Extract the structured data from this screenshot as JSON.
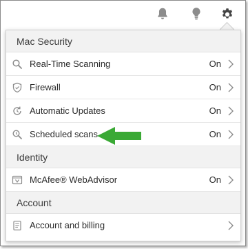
{
  "icons": {
    "bell": "bell-icon",
    "bulb": "lightbulb-icon",
    "gear": "gear-icon"
  },
  "colors": {
    "icon_gray": "#8c8c8c",
    "gear_dark": "#444444",
    "arrow_green": "#3aa935"
  },
  "sections": {
    "mac_security": "Mac Security",
    "identity": "Identity",
    "account": "Account"
  },
  "items": [
    {
      "label": "Real-Time Scanning",
      "status": "On",
      "icon": "search-icon"
    },
    {
      "label": "Firewall",
      "status": "On",
      "icon": "shield-icon"
    },
    {
      "label": "Automatic Updates",
      "status": "On",
      "icon": "refresh-icon"
    },
    {
      "label": "Scheduled scans",
      "status": "On",
      "icon": "scheduled-search-icon"
    },
    {
      "label": "McAfee® WebAdvisor",
      "status": "On",
      "icon": "webadvisor-icon"
    },
    {
      "label": "Account and billing",
      "status": "",
      "icon": "document-icon"
    }
  ]
}
